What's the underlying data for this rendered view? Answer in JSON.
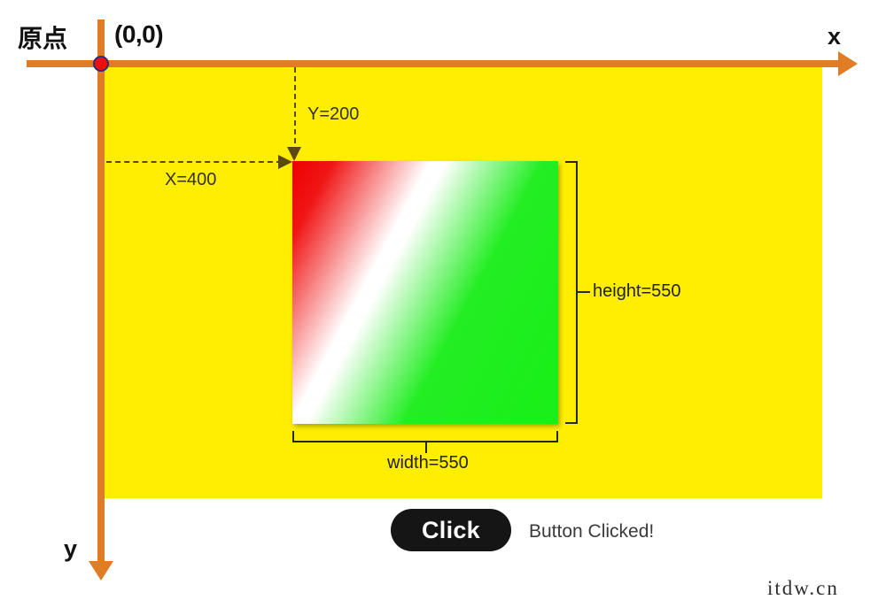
{
  "axes": {
    "x_label": "x",
    "y_label": "y",
    "axis_color": "#e07b26",
    "origin_label": "原点",
    "origin_coordinate": "(0,0)",
    "origin_dot_color": "#f20d0d"
  },
  "canvas": {
    "background_color": "#ffee00"
  },
  "guides": {
    "y_offset_label": "Y=200",
    "x_offset_label": "X=400",
    "guide_color": "#5a4a12"
  },
  "shape": {
    "width_label": "width=550",
    "height_label": "height=550",
    "gradient_start_color": "#ee0000",
    "gradient_mid_color": "#ffffff",
    "gradient_end_color": "#22ee22",
    "bracket_color": "#262626"
  },
  "controls": {
    "click_button_label": "Click",
    "status_message": "Button Clicked!",
    "button_background": "#151515",
    "button_text_color": "#ffffff"
  },
  "watermark": {
    "text": "itdw.cn"
  }
}
